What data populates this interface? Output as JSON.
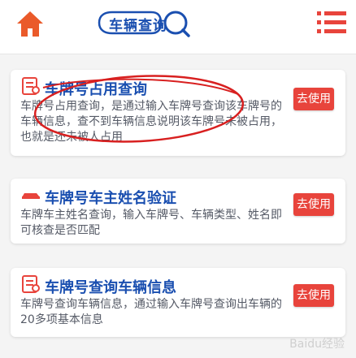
{
  "header": {
    "logo_text": "车辆查询"
  },
  "cards": [
    {
      "title": "车牌号占用查询",
      "description": "车牌号占用查询，是通过输入车牌号查询该车牌号的车辆信息，查不到车辆信息说明该车牌号未被占用，也就是还未被人占用",
      "button": "去使用",
      "icon": "document-icon"
    },
    {
      "title": "车牌号车主姓名验证",
      "description": "车牌车主姓名查询，输入车牌号、车辆类型、姓名即可核查是否匹配",
      "button": "去使用",
      "icon": "car-icon"
    },
    {
      "title": "车牌号查询车辆信息",
      "description": "车牌号查询车辆信息，通过输入车牌号查询出车辆的20多项基本信息",
      "button": "去使用",
      "icon": "document-icon"
    }
  ],
  "watermark": "Baidu经验",
  "colors": {
    "accent": "#e8443c",
    "title": "#1a4fb0",
    "home": "#ea5a2a",
    "menu": "#e8443c"
  }
}
